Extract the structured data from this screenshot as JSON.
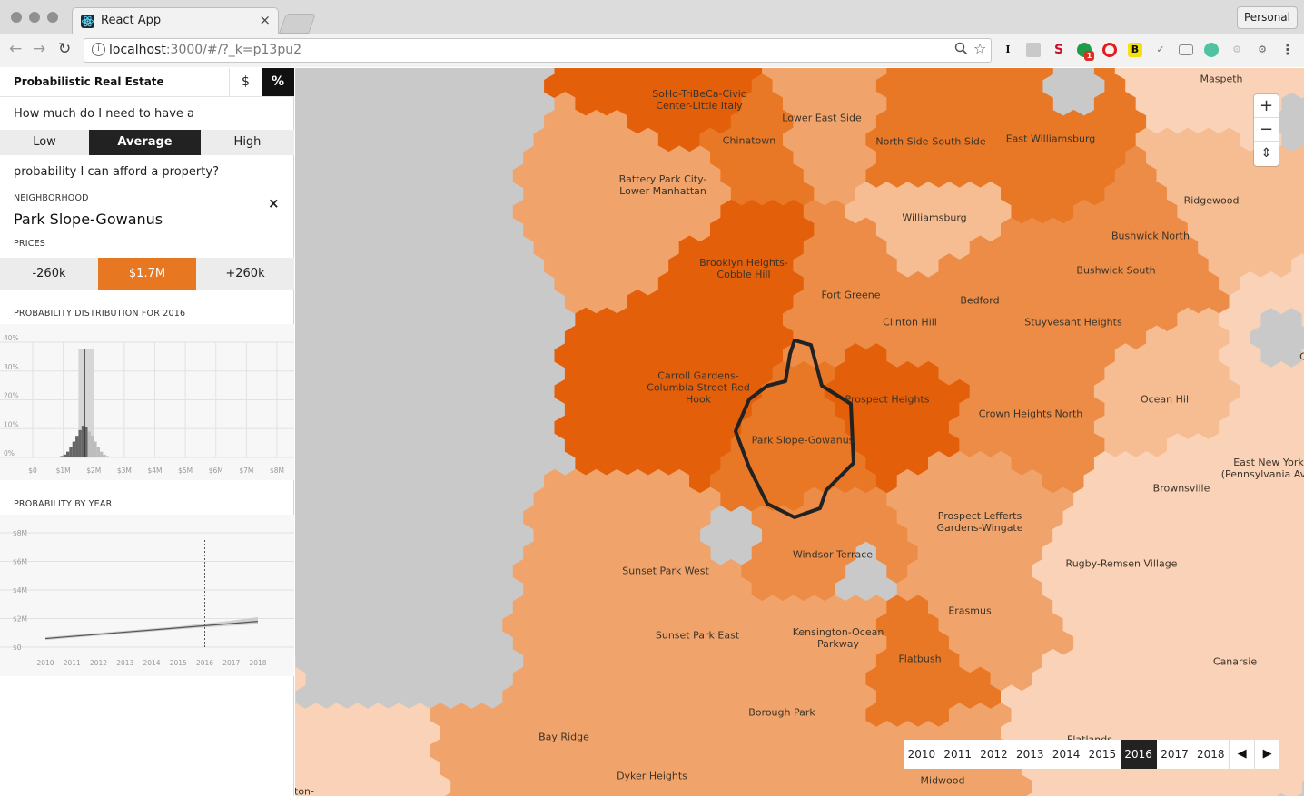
{
  "browser": {
    "tab_title": "React App",
    "tab_close": "×",
    "profile": "Personal",
    "url_host": "localhost",
    "url_rest": ":3000/#/?_k=p13pu2",
    "ext_icons": [
      "I",
      "S",
      "B"
    ],
    "ext_badge": "1"
  },
  "sidebar": {
    "title": "Probabilistic Real Estate",
    "unit_dollar": "$",
    "unit_percent": "%",
    "question_start": "How much do I need to have a",
    "levels": [
      "Low",
      "Average",
      "High"
    ],
    "question_end": "probability I can afford a property?",
    "neighborhood_label": "NEIGHBORHOOD",
    "neighborhood": "Park Slope-Gowanus",
    "close": "×",
    "prices_label": "PRICES",
    "prices": [
      "-260k",
      "$1.7M",
      "+260k"
    ],
    "dist_title": "PROBABILITY DISTRIBUTION FOR 2016",
    "year_title": "PROBABILITY BY YEAR"
  },
  "chart_data": [
    {
      "type": "bar",
      "title": "PROBABILITY DISTRIBUTION FOR 2016",
      "y_ticks": [
        "40%",
        "30%",
        "20%",
        "10%",
        "0%"
      ],
      "x_ticks": [
        "$0",
        "$1M",
        "$2M",
        "$3M",
        "$4M",
        "$5M",
        "$6M",
        "$7M",
        "$8M"
      ],
      "ylim": [
        0,
        40
      ],
      "xlim": [
        0,
        8
      ],
      "x": [
        0.9,
        1.0,
        1.1,
        1.2,
        1.3,
        1.4,
        1.5,
        1.6,
        1.7,
        1.8,
        1.9,
        2.0,
        2.1,
        2.2,
        2.3,
        2.4
      ],
      "values": [
        0.5,
        1,
        2,
        3.5,
        5.5,
        7.5,
        9.5,
        11,
        10.5,
        9,
        7.5,
        5.5,
        3.5,
        2,
        1,
        0.5
      ],
      "marker_x": 1.7,
      "band": [
        1.5,
        2.0
      ],
      "grid": true
    },
    {
      "type": "line",
      "title": "PROBABILITY BY YEAR",
      "y_ticks": [
        "$8M",
        "$6M",
        "$4M",
        "$2M",
        "$0"
      ],
      "x_ticks": [
        "2010",
        "2011",
        "2012",
        "2013",
        "2014",
        "2015",
        "2016",
        "2017",
        "2018"
      ],
      "ylim": [
        0,
        8
      ],
      "x": [
        2010,
        2011,
        2012,
        2013,
        2014,
        2015,
        2016,
        2017,
        2018
      ],
      "values": [
        0.6,
        0.75,
        0.9,
        1.05,
        1.2,
        1.35,
        1.5,
        1.65,
        1.8
      ],
      "upper": [
        0.7,
        0.85,
        1.0,
        1.15,
        1.3,
        1.45,
        1.65,
        1.85,
        2.1
      ],
      "lower": [
        0.5,
        0.65,
        0.8,
        0.95,
        1.1,
        1.25,
        1.38,
        1.5,
        1.6
      ],
      "marker_x": 2016,
      "grid": true
    }
  ],
  "map": {
    "neighborhoods": [
      {
        "name": "SoHo-TriBeCa-Civic\nCenter-Little Italy",
        "color": "#e35f0a"
      },
      {
        "name": "Lower East Side",
        "color": "#f0a46b"
      },
      {
        "name": "Chinatown",
        "color": "#e87826"
      },
      {
        "name": "Maspeth",
        "color": "#fad2b7"
      },
      {
        "name": "North Side-South Side",
        "color": "#e87826"
      },
      {
        "name": "East Williamsburg",
        "color": "#e87826"
      },
      {
        "name": "Battery Park City-\nLower Manhattan",
        "color": "#f0a46b"
      },
      {
        "name": "Ridgewood",
        "color": "#f6bd93"
      },
      {
        "name": "Williamsburg",
        "color": "#f6bd93"
      },
      {
        "name": "Bushwick North",
        "color": "#ec8c47"
      },
      {
        "name": "Brooklyn Heights-\nCobble Hill",
        "color": "#e35f0a"
      },
      {
        "name": "Bushwick South",
        "color": "#ec8c47"
      },
      {
        "name": "Fort Greene",
        "color": "#ec8c47"
      },
      {
        "name": "Bedford",
        "color": "#ec8c47"
      },
      {
        "name": "Clinton Hill",
        "color": "#ec8c47"
      },
      {
        "name": "Stuyvesant Heights",
        "color": "#ec8c47"
      },
      {
        "name": "Carroll Gardens-\nColumbia Street-Red\nHook",
        "color": "#e35f0a"
      },
      {
        "name": "Prospect Heights",
        "color": "#e35f0a"
      },
      {
        "name": "Ocean Hill",
        "color": "#f6bd93"
      },
      {
        "name": "Park Slope-Gowanus",
        "color": "#e87826"
      },
      {
        "name": "Crown Heights North",
        "color": "#ec8c47"
      },
      {
        "name": "East New York\n(Pennsylvania Ave)",
        "color": "#fad2b7"
      },
      {
        "name": "Brownsville",
        "color": "#fad2b7"
      },
      {
        "name": "Prospect Lefferts\nGardens-Wingate",
        "color": "#f0a46b"
      },
      {
        "name": "Windsor Terrace",
        "color": "#ec8c47"
      },
      {
        "name": "Sunset Park West",
        "color": "#f0a46b"
      },
      {
        "name": "Rugby-Remsen Village",
        "color": "#fad2b7"
      },
      {
        "name": "Erasmus",
        "color": "#f0a46b"
      },
      {
        "name": "Kensington-Ocean\nParkway",
        "color": "#f0a46b"
      },
      {
        "name": "Sunset Park East",
        "color": "#f0a46b"
      },
      {
        "name": "Flatbush",
        "color": "#e87826"
      },
      {
        "name": "Canarsie",
        "color": "#fad2b7"
      },
      {
        "name": "Borough Park",
        "color": "#f0a46b"
      },
      {
        "name": "Bay Ridge",
        "color": "#f0a46b"
      },
      {
        "name": "Dyker Heights",
        "color": "#f0a46b"
      },
      {
        "name": "Midwood",
        "color": "#f0a46b"
      },
      {
        "name": "Flatlands",
        "color": "#fad2b7"
      },
      {
        "name": "ton-",
        "color": "#fad2b7"
      },
      {
        "name": "C",
        "color": "#fad2b7"
      }
    ],
    "selected": "Park Slope-Gowanus",
    "zoom_in": "+",
    "zoom_out": "−",
    "compass": "⇕"
  },
  "years": [
    "2010",
    "2011",
    "2012",
    "2013",
    "2014",
    "2015",
    "2016",
    "2017",
    "2018"
  ],
  "active_year": "2016",
  "year_prev": "◀",
  "year_next": "▶",
  "colors": {
    "accent": "#e87722",
    "dark": "#222222",
    "water": "#c9c9c9"
  }
}
